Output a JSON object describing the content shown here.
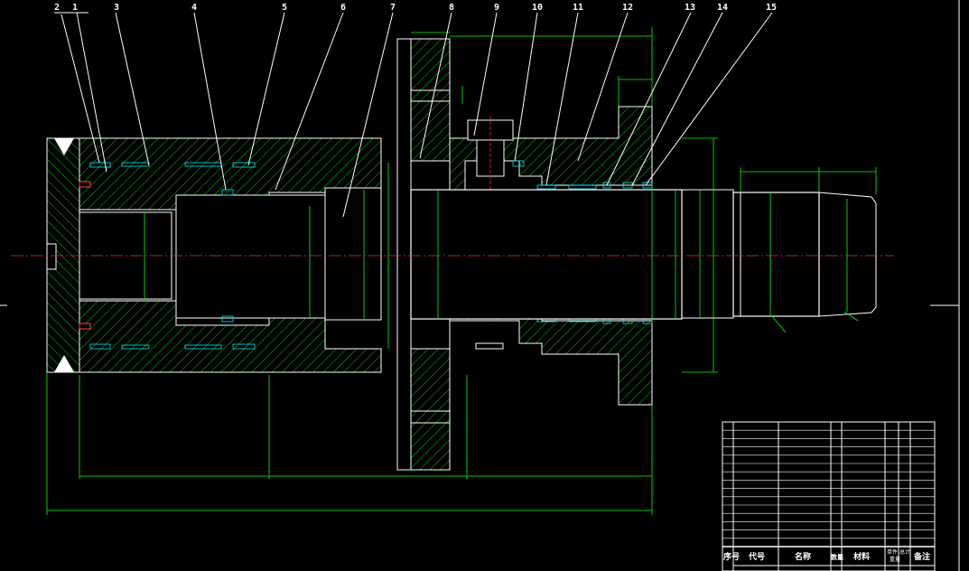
{
  "balloons": [
    "2",
    "1",
    "3",
    "4",
    "5",
    "6",
    "7",
    "8",
    "9",
    "10",
    "11",
    "12",
    "13",
    "14",
    "15"
  ],
  "table_header": {
    "col_no": "序号",
    "col_code": "代号",
    "col_name": "名称",
    "col_qty": "数量",
    "col_material": "材料",
    "col_unit_weight": "单件",
    "col_total_weight": "总计",
    "col_weight": "重量",
    "col_remark": "备注"
  },
  "colors": {
    "background": "#000000",
    "outline": "#ffffff",
    "hatch": "#00ff00",
    "seal": "#00e5ff",
    "centerline": "#ff2a2a"
  }
}
